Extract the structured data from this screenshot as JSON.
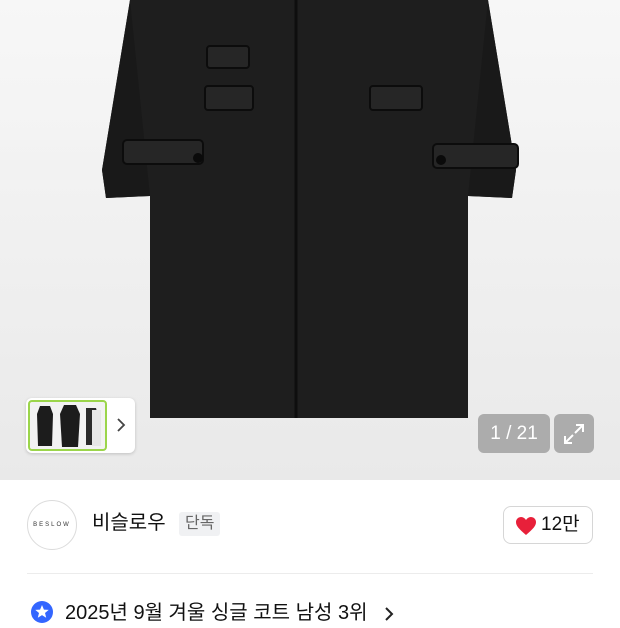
{
  "gallery": {
    "counter": "1 / 21",
    "expand_icon": "expand-arrows-icon",
    "thumb_next_icon": "chevron-right-icon"
  },
  "brand": {
    "logo_text": "BESLOW",
    "name": "비슬로우",
    "badge": "단독",
    "like_icon": "heart-icon",
    "like_color": "#e8203a",
    "likes": "12만"
  },
  "ranking": {
    "icon": "star-badge-icon",
    "icon_color": "#3366ff",
    "text": "2025년 9월 겨울 싱글 코트 남성 3위",
    "chevron": "chevron-right-icon"
  }
}
